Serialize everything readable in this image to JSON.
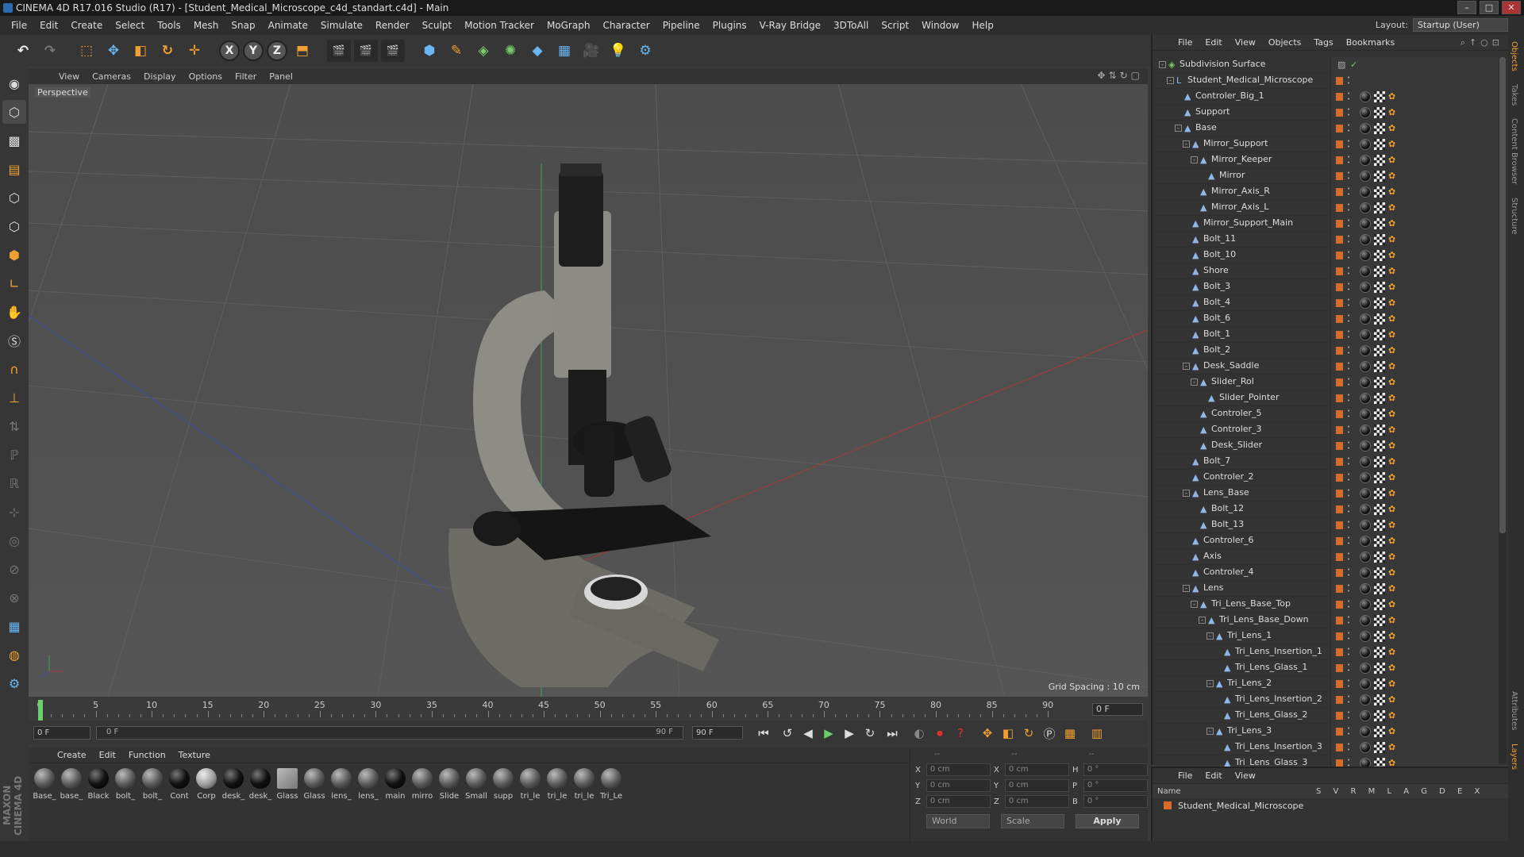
{
  "window": {
    "title": "CINEMA 4D R17.016 Studio (R17) - [Student_Medical_Microscope_c4d_standart.c4d] - Main"
  },
  "menu": [
    "File",
    "Edit",
    "Create",
    "Select",
    "Tools",
    "Mesh",
    "Snap",
    "Animate",
    "Simulate",
    "Render",
    "Sculpt",
    "Motion Tracker",
    "MoGraph",
    "Character",
    "Pipeline",
    "Plugins",
    "V-Ray Bridge",
    "3DToAll",
    "Script",
    "Window",
    "Help"
  ],
  "layout": {
    "label": "Layout:",
    "value": "Startup (User)"
  },
  "viewport": {
    "menu": [
      "View",
      "Cameras",
      "Display",
      "Options",
      "Filter",
      "Panel"
    ],
    "label": "Perspective",
    "grid_spacing": "Grid Spacing : 10 cm"
  },
  "timeline": {
    "ticks": [
      "0",
      "5",
      "10",
      "15",
      "20",
      "25",
      "30",
      "35",
      "40",
      "45",
      "50",
      "55",
      "60",
      "65",
      "70",
      "75",
      "80",
      "85",
      "90"
    ],
    "current_frame": "0 F",
    "start": "0 F",
    "slider_left": "0 F",
    "slider_right": "90 F",
    "end": "90 F"
  },
  "materials": {
    "menu": [
      "Create",
      "Edit",
      "Function",
      "Texture"
    ],
    "items": [
      "Base_",
      "base_",
      "Black",
      "bolt_",
      "bolt_",
      "Cont",
      "Corp",
      "desk_",
      "desk_",
      "Glass",
      "Glass",
      "lens_",
      "lens_",
      "main",
      "mirro",
      "Slide",
      "Small",
      "supp",
      "tri_le",
      "tri_le",
      "tri_le",
      "Tri_Le"
    ]
  },
  "coords": {
    "headers": [
      "--",
      "--",
      "--"
    ],
    "rows": [
      {
        "a": "X",
        "av": "0 cm",
        "b": "X",
        "bv": "0 cm",
        "c": "H",
        "cv": "0 °"
      },
      {
        "a": "Y",
        "av": "0 cm",
        "b": "Y",
        "bv": "0 cm",
        "c": "P",
        "cv": "0 °"
      },
      {
        "a": "Z",
        "av": "0 cm",
        "b": "Z",
        "bv": "0 cm",
        "c": "B",
        "cv": "0 °"
      }
    ],
    "world": "World",
    "scale": "Scale",
    "apply": "Apply"
  },
  "objects": {
    "menu": [
      "File",
      "Edit",
      "View",
      "Objects",
      "Tags",
      "Bookmarks"
    ],
    "rows": [
      {
        "name": "Subdivision Surface",
        "depth": 0,
        "exp": "-",
        "icon": "subdiv"
      },
      {
        "name": "Student_Medical_Microscope",
        "depth": 1,
        "exp": "-",
        "icon": "null"
      },
      {
        "name": "Controler_Big_1",
        "depth": 2,
        "exp": "",
        "icon": "poly"
      },
      {
        "name": "Support",
        "depth": 2,
        "exp": "",
        "icon": "poly"
      },
      {
        "name": "Base",
        "depth": 2,
        "exp": "-",
        "icon": "poly"
      },
      {
        "name": "Mirror_Support",
        "depth": 3,
        "exp": "-",
        "icon": "poly"
      },
      {
        "name": "Mirror_Keeper",
        "depth": 4,
        "exp": "-",
        "icon": "poly"
      },
      {
        "name": "Mirror",
        "depth": 5,
        "exp": "",
        "icon": "poly"
      },
      {
        "name": "Mirror_Axis_R",
        "depth": 4,
        "exp": "",
        "icon": "poly"
      },
      {
        "name": "Mirror_Axis_L",
        "depth": 4,
        "exp": "",
        "icon": "poly"
      },
      {
        "name": "Mirror_Support_Main",
        "depth": 3,
        "exp": "",
        "icon": "poly"
      },
      {
        "name": "Bolt_11",
        "depth": 3,
        "exp": "",
        "icon": "poly"
      },
      {
        "name": "Bolt_10",
        "depth": 3,
        "exp": "",
        "icon": "poly"
      },
      {
        "name": "Shore",
        "depth": 3,
        "exp": "",
        "icon": "poly"
      },
      {
        "name": "Bolt_3",
        "depth": 3,
        "exp": "",
        "icon": "poly"
      },
      {
        "name": "Bolt_4",
        "depth": 3,
        "exp": "",
        "icon": "poly"
      },
      {
        "name": "Bolt_6",
        "depth": 3,
        "exp": "",
        "icon": "poly"
      },
      {
        "name": "Bolt_1",
        "depth": 3,
        "exp": "",
        "icon": "poly"
      },
      {
        "name": "Bolt_2",
        "depth": 3,
        "exp": "",
        "icon": "poly"
      },
      {
        "name": "Desk_Saddle",
        "depth": 3,
        "exp": "-",
        "icon": "poly"
      },
      {
        "name": "Slider_Rol",
        "depth": 4,
        "exp": "-",
        "icon": "poly"
      },
      {
        "name": "Slider_Pointer",
        "depth": 5,
        "exp": "",
        "icon": "poly"
      },
      {
        "name": "Controler_5",
        "depth": 4,
        "exp": "",
        "icon": "poly"
      },
      {
        "name": "Controler_3",
        "depth": 4,
        "exp": "",
        "icon": "poly"
      },
      {
        "name": "Desk_Slider",
        "depth": 4,
        "exp": "",
        "icon": "poly"
      },
      {
        "name": "Bolt_7",
        "depth": 3,
        "exp": "",
        "icon": "poly"
      },
      {
        "name": "Controler_2",
        "depth": 3,
        "exp": "",
        "icon": "poly"
      },
      {
        "name": "Lens_Base",
        "depth": 3,
        "exp": "-",
        "icon": "poly"
      },
      {
        "name": "Bolt_12",
        "depth": 4,
        "exp": "",
        "icon": "poly"
      },
      {
        "name": "Bolt_13",
        "depth": 4,
        "exp": "",
        "icon": "poly"
      },
      {
        "name": "Controler_6",
        "depth": 3,
        "exp": "",
        "icon": "poly"
      },
      {
        "name": "Axis",
        "depth": 3,
        "exp": "",
        "icon": "poly"
      },
      {
        "name": "Controler_4",
        "depth": 3,
        "exp": "",
        "icon": "poly"
      },
      {
        "name": "Lens",
        "depth": 3,
        "exp": "-",
        "icon": "poly"
      },
      {
        "name": "Tri_Lens_Base_Top",
        "depth": 4,
        "exp": "-",
        "icon": "poly"
      },
      {
        "name": "Tri_Lens_Base_Down",
        "depth": 5,
        "exp": "-",
        "icon": "poly"
      },
      {
        "name": "Tri_Lens_1",
        "depth": 6,
        "exp": "-",
        "icon": "poly"
      },
      {
        "name": "Tri_Lens_Insertion_1",
        "depth": 7,
        "exp": "",
        "icon": "poly"
      },
      {
        "name": "Tri_Lens_Glass_1",
        "depth": 7,
        "exp": "",
        "icon": "poly"
      },
      {
        "name": "Tri_Lens_2",
        "depth": 6,
        "exp": "-",
        "icon": "poly"
      },
      {
        "name": "Tri_Lens_Insertion_2",
        "depth": 7,
        "exp": "",
        "icon": "poly"
      },
      {
        "name": "Tri_Lens_Glass_2",
        "depth": 7,
        "exp": "",
        "icon": "poly"
      },
      {
        "name": "Tri_Lens_3",
        "depth": 6,
        "exp": "-",
        "icon": "poly"
      },
      {
        "name": "Tri_Lens_Insertion_3",
        "depth": 7,
        "exp": "",
        "icon": "poly"
      },
      {
        "name": "Tri_Lens_Glass_3",
        "depth": 7,
        "exp": "",
        "icon": "poly"
      }
    ]
  },
  "layers": {
    "menu": [
      "File",
      "Edit",
      "View"
    ],
    "header_name": "Name",
    "header_flags": "S V R M L A G D E X",
    "row": "Student_Medical_Microscope"
  },
  "right_tabs": [
    "Objects",
    "Takes",
    "Content Browser",
    "Structure",
    "Attributes",
    "Layers"
  ],
  "brand": "MAXON CINEMA 4D",
  "colors": {
    "accent": "#f0a030",
    "layer": "#d86a2a",
    "bg": "#3a3a3a"
  }
}
